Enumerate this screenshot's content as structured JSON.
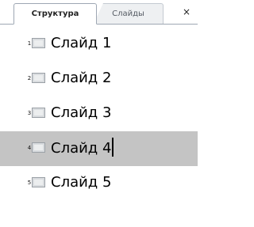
{
  "tabs": {
    "outline_label": "Структура",
    "slides_label": "Слайды",
    "close_glyph": "×"
  },
  "slides": [
    {
      "number": "1",
      "title": "Слайд 1",
      "selected": false
    },
    {
      "number": "2",
      "title": "Слайд 2",
      "selected": false
    },
    {
      "number": "3",
      "title": "Слайд 3",
      "selected": false
    },
    {
      "number": "4",
      "title": "Слайд 4",
      "selected": true
    },
    {
      "number": "5",
      "title": "Слайд 5",
      "selected": false
    }
  ]
}
